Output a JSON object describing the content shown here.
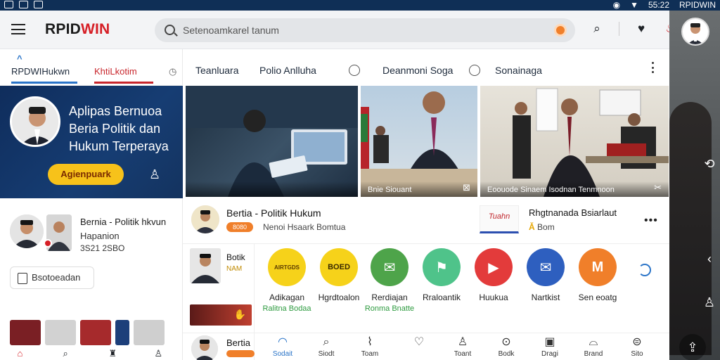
{
  "status_bar": {
    "time": "55:22",
    "right_label": "RPIDWIN"
  },
  "app": {
    "logo_part1": "RPID",
    "logo_part2": "WIN",
    "search_placeholder": "Setenoamkarel tanum"
  },
  "left": {
    "tabs": [
      "RPDWIHukwn",
      "KhtiLkotim"
    ],
    "hero": {
      "headline_line1": "Aplipas Bernuoa",
      "headline_line2": "Beria Politik dan",
      "headline_line3": "Hukum Terperaya",
      "cta": "Agienpuark"
    },
    "card": {
      "title": "Bernia - Politik hkvun",
      "sub1": "Hapanion",
      "sub2": "3S21 2SBO"
    },
    "button": "Bsotoeadan"
  },
  "main": {
    "tabs": [
      "Teanluara",
      "Polio Anlluha",
      "Deanmoni Soga",
      "Sonainaga"
    ],
    "photos": [
      {
        "caption": ""
      },
      {
        "caption": "Bnie  Siouant"
      },
      {
        "caption": "Eoouode Sinaem  Isodnan  Tenmnoon"
      }
    ],
    "news": {
      "title": "Bertia - Politik Hukum",
      "badge": "8080",
      "sub": "Nenoi Hsaark Bomtua",
      "logo_text": "Tuahn",
      "title2": "Rhgtnanada Bsiarlaut",
      "sub2_a": "Ǎ",
      "sub2_b": "Bom"
    },
    "side": {
      "title": "Botik",
      "sub": "NAM"
    },
    "categories": [
      {
        "icon": "AIRTGDS",
        "label1": "Adikagan",
        "label2": "Ralitna Bodaa",
        "color": "#f6d21a"
      },
      {
        "icon": "BOED",
        "label1": "Hgrdtoalon",
        "label2": "",
        "color": "#f6d21a"
      },
      {
        "icon": "✉",
        "label1": "Rerdiajan",
        "label2": "Ronma Bnatte",
        "color": "#4ea44a"
      },
      {
        "icon": "⚑",
        "label1": "Rraloantik",
        "label2": "",
        "color": "#4fc38a"
      },
      {
        "icon": "▶",
        "label1": "Huukua",
        "label2": "",
        "color": "#e33b3b"
      },
      {
        "icon": "✉",
        "label1": "Nartkist",
        "label2": "",
        "color": "#2e5fbf"
      },
      {
        "icon": "M",
        "label1": "Sen eoatg",
        "label2": "",
        "color": "#f07f2a"
      }
    ],
    "bottom": {
      "title": "Bertia",
      "nav": [
        "Sodait",
        "Siodt",
        "Toam",
        "",
        "Toant",
        "Bodk",
        "Dragi",
        "Brand",
        "Sito"
      ]
    }
  }
}
